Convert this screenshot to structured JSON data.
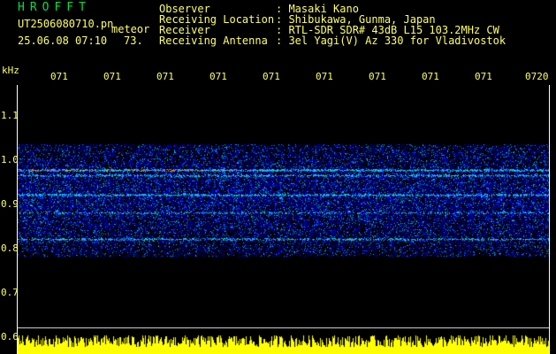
{
  "app": {
    "title": "HROFFT"
  },
  "file": {
    "name": "UT2506080710.pn",
    "tag": "meteor",
    "datetime": "25.06.08 07:10",
    "count": "73."
  },
  "header": [
    {
      "key": "Observer",
      "value": ": Masaki Kano"
    },
    {
      "key": "Receiving Location",
      "value": ": Shibukawa, Gunma, Japan"
    },
    {
      "key": "Receiver",
      "value": ": RTL-SDR SDR# 43dB L15 103.2MHz CW"
    },
    {
      "key": "Receiving Antenna",
      "value": ": 3el Yagi(V) Az 330 for Vladivostok"
    }
  ],
  "axis": {
    "y_unit": "kHz",
    "x_ticks": [
      "071",
      "071",
      "071",
      "071",
      "071",
      "071",
      "071",
      "071",
      "071",
      "0720"
    ],
    "y_ticks": [
      "1.1",
      "1.0",
      "0.9",
      "0.8",
      "0.7",
      "0.6"
    ]
  },
  "colors": {
    "label": "#ffff66",
    "title": "#00e040",
    "background": "#000000"
  }
}
